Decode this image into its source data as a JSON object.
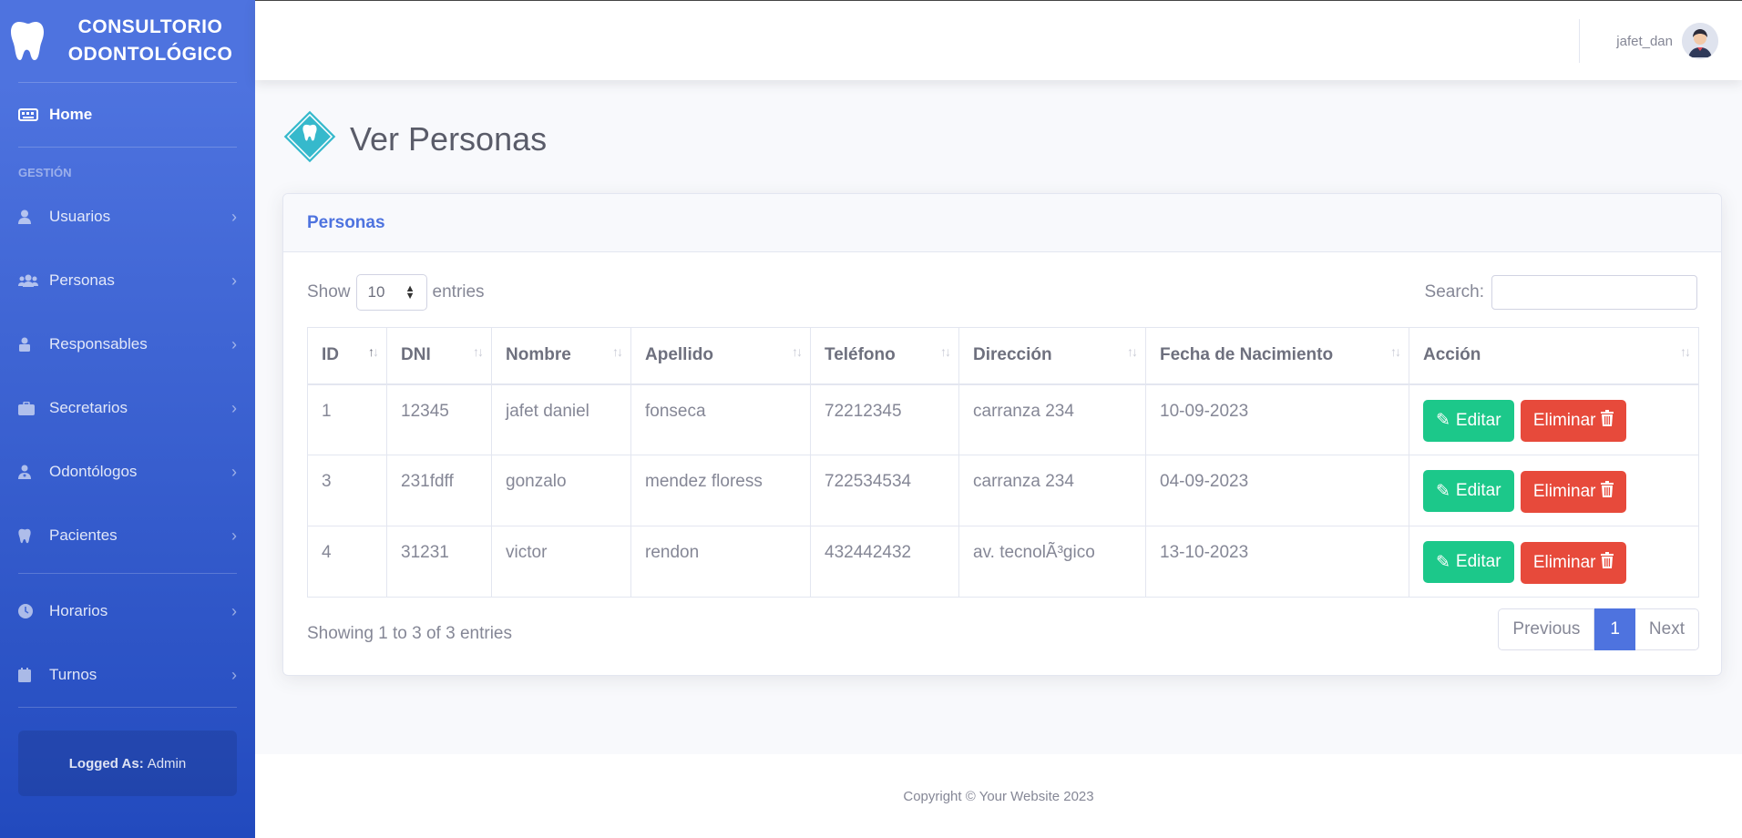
{
  "brand": {
    "line1": "CONSULTORIO",
    "line2": "ODONTOLÓGICO"
  },
  "sidebar": {
    "home": "Home",
    "heading": "GESTIÓN",
    "items": [
      {
        "label": "Usuarios",
        "icon": "user-icon"
      },
      {
        "label": "Personas",
        "icon": "users-icon"
      },
      {
        "label": "Responsables",
        "icon": "user-lock-icon"
      },
      {
        "label": "Secretarios",
        "icon": "briefcase-icon"
      },
      {
        "label": "Odontólogos",
        "icon": "user-doctor-icon"
      },
      {
        "label": "Pacientes",
        "icon": "tooth-icon"
      },
      {
        "label": "Horarios",
        "icon": "clock-icon"
      },
      {
        "label": "Turnos",
        "icon": "calendar-icon"
      }
    ],
    "logged_label": "Logged As:",
    "logged_value": "Admin"
  },
  "topbar": {
    "username": "jafet_dan"
  },
  "page": {
    "title": "Ver Personas"
  },
  "card": {
    "title": "Personas",
    "show_label": "Show",
    "entries_value": "10",
    "entries_label": "entries",
    "search_label": "Search:",
    "search_value": "",
    "columns": [
      "ID",
      "DNI",
      "Nombre",
      "Apellido",
      "Teléfono",
      "Dirección",
      "Fecha de Nacimiento",
      "Acción"
    ],
    "rows": [
      {
        "id": "1",
        "dni": "12345",
        "nombre": "jafet daniel",
        "apellido": "fonseca",
        "telefono": "72212345",
        "direccion": "carranza 234",
        "fecha": "10-09-2023"
      },
      {
        "id": "3",
        "dni": "231fdff",
        "nombre": "gonzalo",
        "apellido": "mendez floress",
        "telefono": "722534534",
        "direccion": "carranza 234",
        "fecha": "04-09-2023"
      },
      {
        "id": "4",
        "dni": "31231",
        "nombre": "victor",
        "apellido": "rendon",
        "telefono": "432442432",
        "direccion": "av. tecnolÃ³gico",
        "fecha": "13-10-2023"
      }
    ],
    "edit_label": "Editar",
    "delete_label": "Eliminar",
    "info": "Showing 1 to 3 of 3 entries",
    "pager": {
      "prev": "Previous",
      "page": "1",
      "next": "Next"
    }
  },
  "footer": {
    "text": "Copyright © Your Website 2023"
  },
  "colors": {
    "primary": "#4e73df",
    "success": "#1cc88a",
    "danger": "#e74a3b"
  }
}
